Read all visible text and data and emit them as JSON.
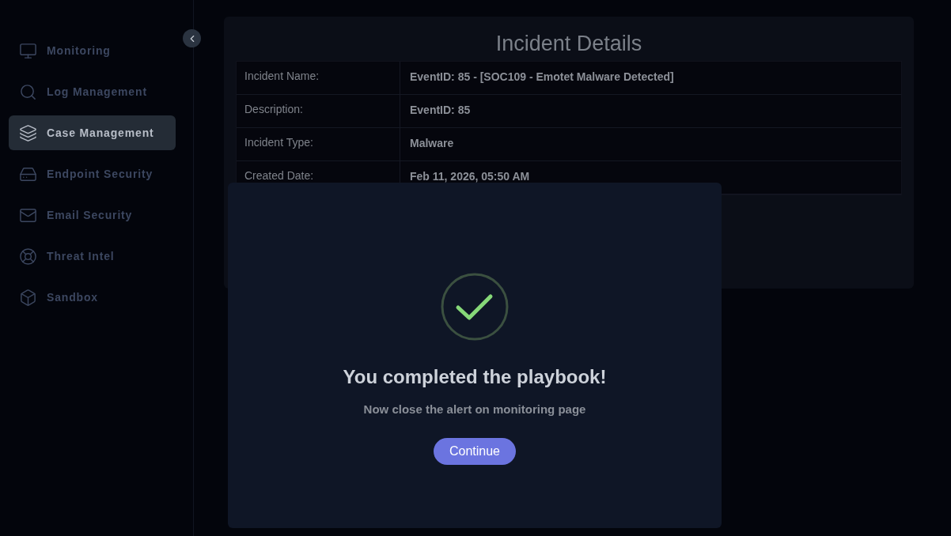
{
  "sidebar": {
    "items": [
      {
        "label": "Monitoring",
        "selected": false
      },
      {
        "label": "Log Management",
        "selected": false
      },
      {
        "label": "Case Management",
        "selected": true
      },
      {
        "label": "Endpoint Security",
        "selected": false
      },
      {
        "label": "Email Security",
        "selected": false
      },
      {
        "label": "Threat Intel",
        "selected": false
      },
      {
        "label": "Sandbox",
        "selected": false
      }
    ]
  },
  "panel": {
    "title": "Incident Details",
    "rows": [
      {
        "label": "Incident Name:",
        "value": "EventID: 85 - [SOC109 - Emotet Malware Detected]"
      },
      {
        "label": "Description:",
        "value": "EventID: 85"
      },
      {
        "label": "Incident Type:",
        "value": "Malware"
      },
      {
        "label": "Created Date:",
        "value": "Feb 11, 2026, 05:50 AM"
      }
    ]
  },
  "dialog": {
    "title": "You completed the playbook!",
    "message": "Now close the alert on monitoring page",
    "button": "Continue"
  }
}
